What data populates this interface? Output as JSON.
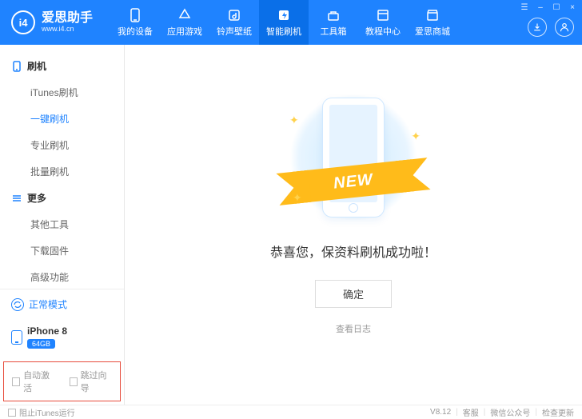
{
  "header": {
    "logo_text": "i4",
    "brand": "爱思助手",
    "brand_sub": "www.i4.cn",
    "navs": [
      {
        "label": "我的设备",
        "icon": "device"
      },
      {
        "label": "应用游戏",
        "icon": "apps"
      },
      {
        "label": "铃声壁纸",
        "icon": "music"
      },
      {
        "label": "智能刷机",
        "icon": "flash",
        "active": true
      },
      {
        "label": "工具箱",
        "icon": "toolbox"
      },
      {
        "label": "教程中心",
        "icon": "book"
      },
      {
        "label": "爱思商城",
        "icon": "shop"
      }
    ],
    "win_top": [
      "☰",
      "–",
      "☐",
      "×"
    ],
    "side": [
      "download",
      "user"
    ]
  },
  "sidebar": {
    "group1": {
      "label": "刷机",
      "items": [
        {
          "label": "iTunes刷机"
        },
        {
          "label": "一键刷机",
          "active": true
        },
        {
          "label": "专业刷机"
        },
        {
          "label": "批量刷机"
        }
      ]
    },
    "group2": {
      "label": "更多",
      "items": [
        {
          "label": "其他工具"
        },
        {
          "label": "下载固件"
        },
        {
          "label": "高级功能"
        }
      ]
    },
    "mode_label": "正常模式",
    "device_name": "iPhone 8",
    "device_badge": "64GB",
    "checks": [
      "自动激活",
      "跳过向导"
    ]
  },
  "main": {
    "ribbon": "NEW",
    "success": "恭喜您，保资料刷机成功啦！",
    "ok": "确定",
    "log": "查看日志"
  },
  "footer": {
    "block_itunes": "阻止iTunes运行",
    "version": "V8.12",
    "links": [
      "客服",
      "微信公众号",
      "检查更新"
    ]
  }
}
